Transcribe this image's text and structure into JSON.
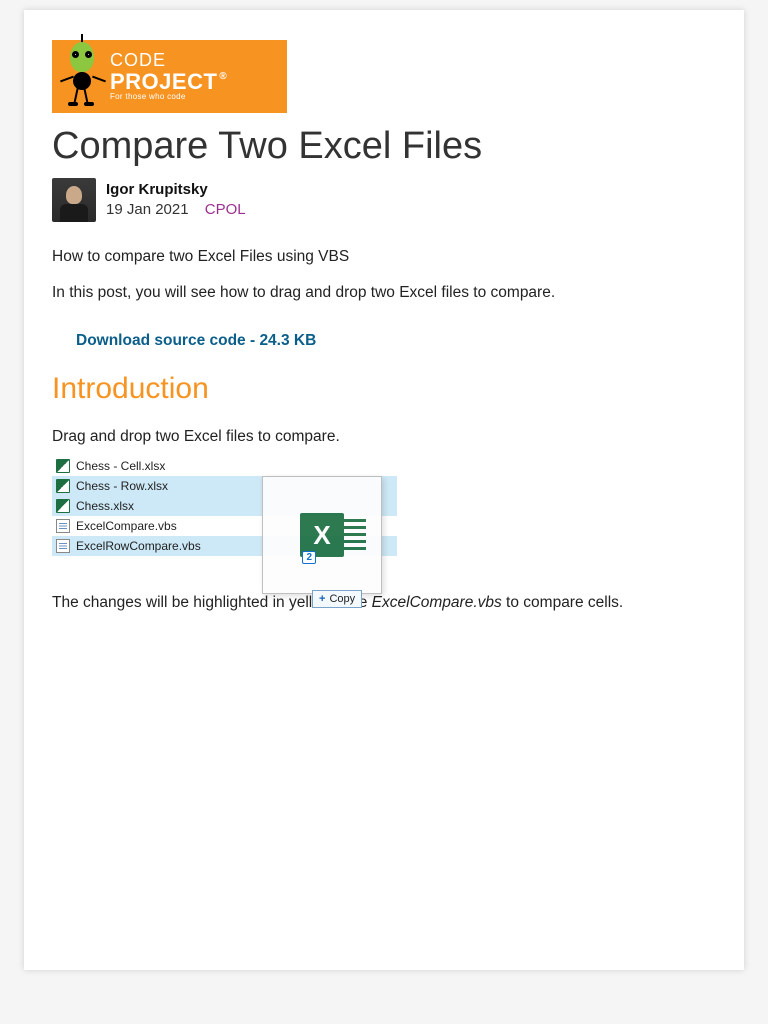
{
  "logo": {
    "line1": "CODE",
    "line2": "PROJECT",
    "tagline": "For those who code",
    "registered": "®"
  },
  "article": {
    "title": "Compare Two Excel Files",
    "author": "Igor Krupitsky",
    "date": "19 Jan 2021",
    "license": "CPOL",
    "summary1": "How to compare two Excel Files using VBS",
    "summary2": "In this post, you will see how to drag and drop two Excel files to compare.",
    "download": "Download source code - 24.3 KB"
  },
  "sections": {
    "intro_heading": "Introduction",
    "intro_para": "Drag and drop two Excel files to compare.",
    "after_image_prefix": "The changes will be highlighted in yellow. Use ",
    "after_image_em": "ExcelCompare.vbs",
    "after_image_suffix": " to compare cells."
  },
  "files": {
    "f1": "Chess - Cell.xlsx",
    "f2": "Chess - Row.xlsx",
    "f3": "Chess.xlsx",
    "f4": "ExcelCompare.vbs",
    "f5": "ExcelRowCompare.vbs"
  },
  "drag": {
    "badge_count": "2",
    "copy_label": "Copy",
    "x_glyph": "X"
  }
}
